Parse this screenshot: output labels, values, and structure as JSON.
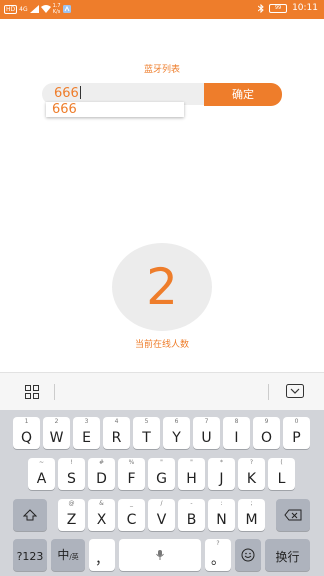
{
  "status_bar": {
    "hd": "HD",
    "signal": "4G",
    "speed_value": "1.7",
    "speed_unit": "K/s",
    "battery": "99",
    "time": "10:11"
  },
  "title": "蓝牙列表",
  "input": {
    "value": "666"
  },
  "suggestion": "666",
  "confirm_label": "确定",
  "online_count": "2",
  "online_label": "当前在线人数",
  "keyboard": {
    "row1": [
      {
        "k": "Q",
        "s": "1"
      },
      {
        "k": "W",
        "s": "2"
      },
      {
        "k": "E",
        "s": "3"
      },
      {
        "k": "R",
        "s": "4"
      },
      {
        "k": "T",
        "s": "5"
      },
      {
        "k": "Y",
        "s": "6"
      },
      {
        "k": "U",
        "s": "7"
      },
      {
        "k": "I",
        "s": "8"
      },
      {
        "k": "O",
        "s": "9"
      },
      {
        "k": "P",
        "s": "0"
      }
    ],
    "row2": [
      {
        "k": "A",
        "s": "~"
      },
      {
        "k": "S",
        "s": "!"
      },
      {
        "k": "D",
        "s": "#"
      },
      {
        "k": "F",
        "s": "%"
      },
      {
        "k": "G",
        "s": "\""
      },
      {
        "k": "H",
        "s": "\""
      },
      {
        "k": "J",
        "s": "*"
      },
      {
        "k": "K",
        "s": "?"
      },
      {
        "k": "L",
        "s": "("
      }
    ],
    "row3": [
      {
        "k": "Z",
        "s": "@"
      },
      {
        "k": "X",
        "s": "&"
      },
      {
        "k": "C",
        "s": "_"
      },
      {
        "k": "V",
        "s": "/"
      },
      {
        "k": "B",
        "s": "-"
      },
      {
        "k": "N",
        "s": ":"
      },
      {
        "k": "M",
        "s": ";"
      }
    ],
    "num_key": "?123",
    "lang_key": "中",
    "lang_sub": "/英",
    "comma": "，",
    "period": "。",
    "period_sub": "?",
    "enter_key": "换行"
  },
  "icons": {
    "grid": "grid-icon",
    "collapse": "keyboard-collapse-icon",
    "shift": "shift-icon",
    "backspace": "backspace-icon",
    "mic": "microphone-icon",
    "emoji": "emoji-icon"
  },
  "colors": {
    "accent": "#ee7d2b",
    "keyboard_bg": "#d2d4d9"
  }
}
